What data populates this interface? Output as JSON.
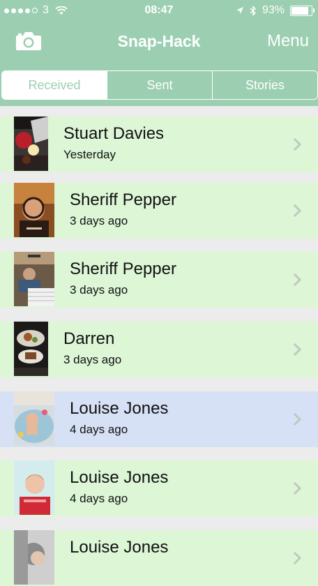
{
  "status_bar": {
    "carrier": "3",
    "time": "08:47",
    "battery": "93%",
    "battery_level": 0.93
  },
  "navbar": {
    "title": "Snap-Hack",
    "menu_label": "Menu",
    "camera_icon": "camera-icon"
  },
  "tabs": [
    {
      "label": "Received",
      "selected": true
    },
    {
      "label": "Sent",
      "selected": false
    },
    {
      "label": "Stories",
      "selected": false
    }
  ],
  "snaps": [
    {
      "name": "Stuart Davies",
      "time": "Yesterday",
      "highlighted": false
    },
    {
      "name": "Sheriff Pepper",
      "time": "3 days ago",
      "highlighted": false
    },
    {
      "name": "Sheriff Pepper",
      "time": "3 days ago",
      "highlighted": false
    },
    {
      "name": "Darren",
      "time": "3 days ago",
      "highlighted": false
    },
    {
      "name": "Louise Jones",
      "time": "4 days ago",
      "highlighted": true
    },
    {
      "name": "Louise Jones",
      "time": "4 days ago",
      "highlighted": false
    },
    {
      "name": "Louise Jones",
      "time": "",
      "highlighted": false
    }
  ],
  "colors": {
    "header": "#9ccfb1",
    "row": "#dcf6d6",
    "row_highlight": "#d7e1f6",
    "separator": "#ececec"
  }
}
